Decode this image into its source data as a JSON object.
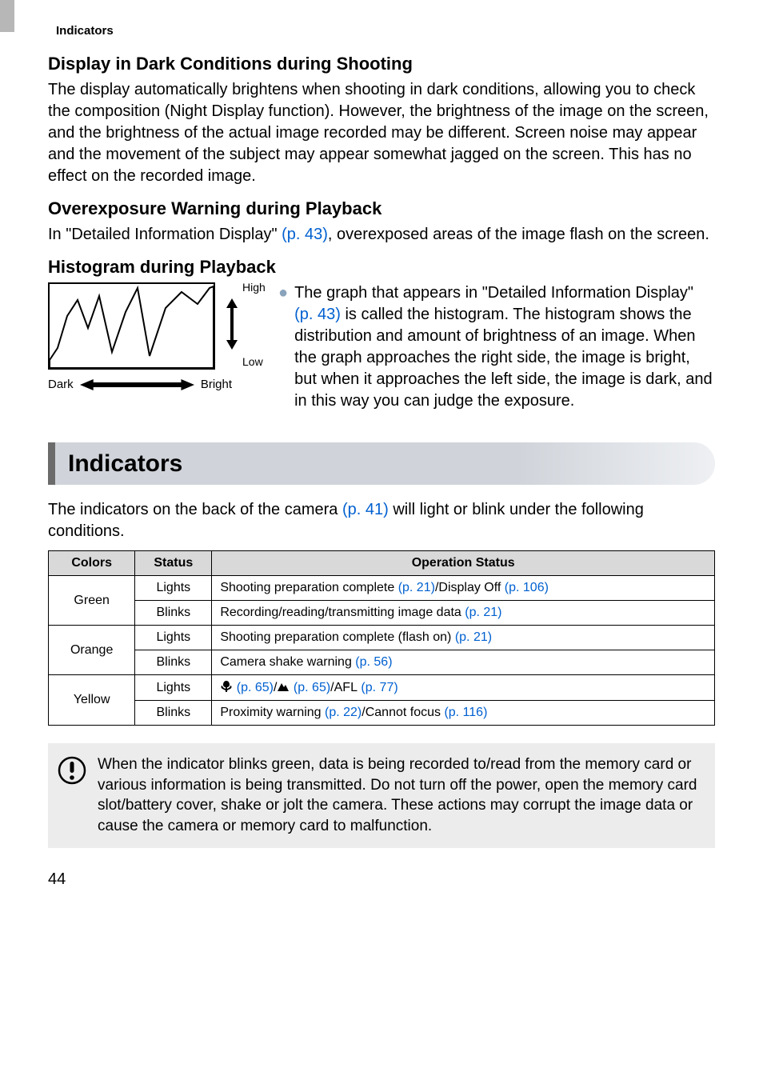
{
  "header_path": "Indicators",
  "sec1": {
    "title": "Display in Dark Conditions during Shooting",
    "body": "The display automatically brightens when shooting in dark conditions, allowing you to check the composition (Night Display function). However, the brightness of the image on the screen, and the brightness of the actual image recorded may be different. Screen noise may appear and the movement of the subject may appear somewhat jagged on the screen. This has no effect on the recorded image."
  },
  "sec2": {
    "title": "Overexposure Warning during Playback",
    "body_a": "In \"Detailed Information Display\" ",
    "body_link": "(p. 43)",
    "body_b": ", overexposed areas of the image flash on the screen."
  },
  "sec3": {
    "title": "Histogram during Playback",
    "fig": {
      "high": "High",
      "low": "Low",
      "dark": "Dark",
      "bright": "Bright"
    },
    "bullet_a": "The graph that appears in \"Detailed Information Display\" ",
    "bullet_link": "(p. 43)",
    "bullet_b": " is called the histogram. The histogram shows the distribution and amount of brightness of an image. When the graph approaches the right side, the image is bright, but when it approaches the left side, the image is dark, and in this way you can judge the exposure."
  },
  "indicators": {
    "banner": "Indicators",
    "intro_a": "The indicators on the back of the camera ",
    "intro_link": "(p. 41)",
    "intro_b": " will light or blink under the following conditions.",
    "headers": {
      "colors": "Colors",
      "status": "Status",
      "op": "Operation Status"
    },
    "rows": [
      {
        "color": "Green",
        "lights_label": "Lights",
        "lights_text_a": "Shooting preparation complete ",
        "lights_link1": "(p. 21)",
        "lights_text_b": "/Display Off ",
        "lights_link2": "(p. 106)",
        "blinks_label": "Blinks",
        "blinks_text_a": "Recording/reading/transmitting image data ",
        "blinks_link1": "(p. 21)"
      },
      {
        "color": "Orange",
        "lights_label": "Lights",
        "lights_text_a": "Shooting preparation complete (flash on) ",
        "lights_link1": "(p. 21)",
        "blinks_label": "Blinks",
        "blinks_text_a": "Camera shake warning ",
        "blinks_link1": "(p. 56)"
      },
      {
        "color": "Yellow",
        "lights_label": "Lights",
        "lights_link1": "(p. 65)",
        "lights_sep1": "/",
        "lights_link2": "(p. 65)",
        "lights_sep2": "/",
        "lights_afl": "AFL",
        "lights_link3": "(p. 77)",
        "blinks_label": "Blinks",
        "blinks_text_a": "Proximity warning ",
        "blinks_link1": "(p. 22)",
        "blinks_text_b": "/Cannot focus ",
        "blinks_link2": "(p. 116)"
      }
    ]
  },
  "note": "When the indicator blinks green, data is being recorded to/read from the memory card or various information is being transmitted. Do not turn off the power, open the memory card slot/battery cover, shake or jolt the camera. These actions may corrupt the image data or cause the camera or memory card to malfunction.",
  "pagenum": "44"
}
